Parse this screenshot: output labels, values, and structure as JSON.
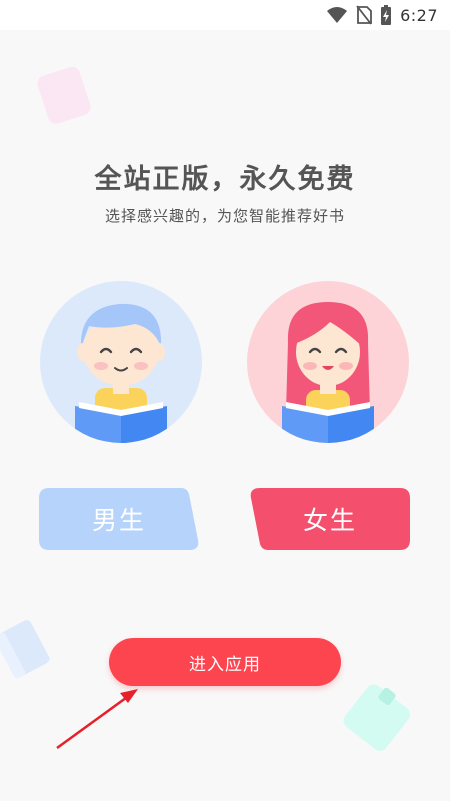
{
  "status_bar": {
    "time": "6:27",
    "icons": [
      "wifi-icon",
      "no-sim-icon",
      "battery-charging-icon"
    ]
  },
  "header": {
    "title": "全站正版，永久免费",
    "subtitle": "选择感兴趣的，为您智能推荐好书"
  },
  "gender": {
    "male_label": "男生",
    "female_label": "女生"
  },
  "enter_button": {
    "label": "进入应用"
  },
  "colors": {
    "male": "#b6d3fb",
    "female": "#f4506e",
    "primary": "#fd4550",
    "arrow": "#e8202a"
  }
}
